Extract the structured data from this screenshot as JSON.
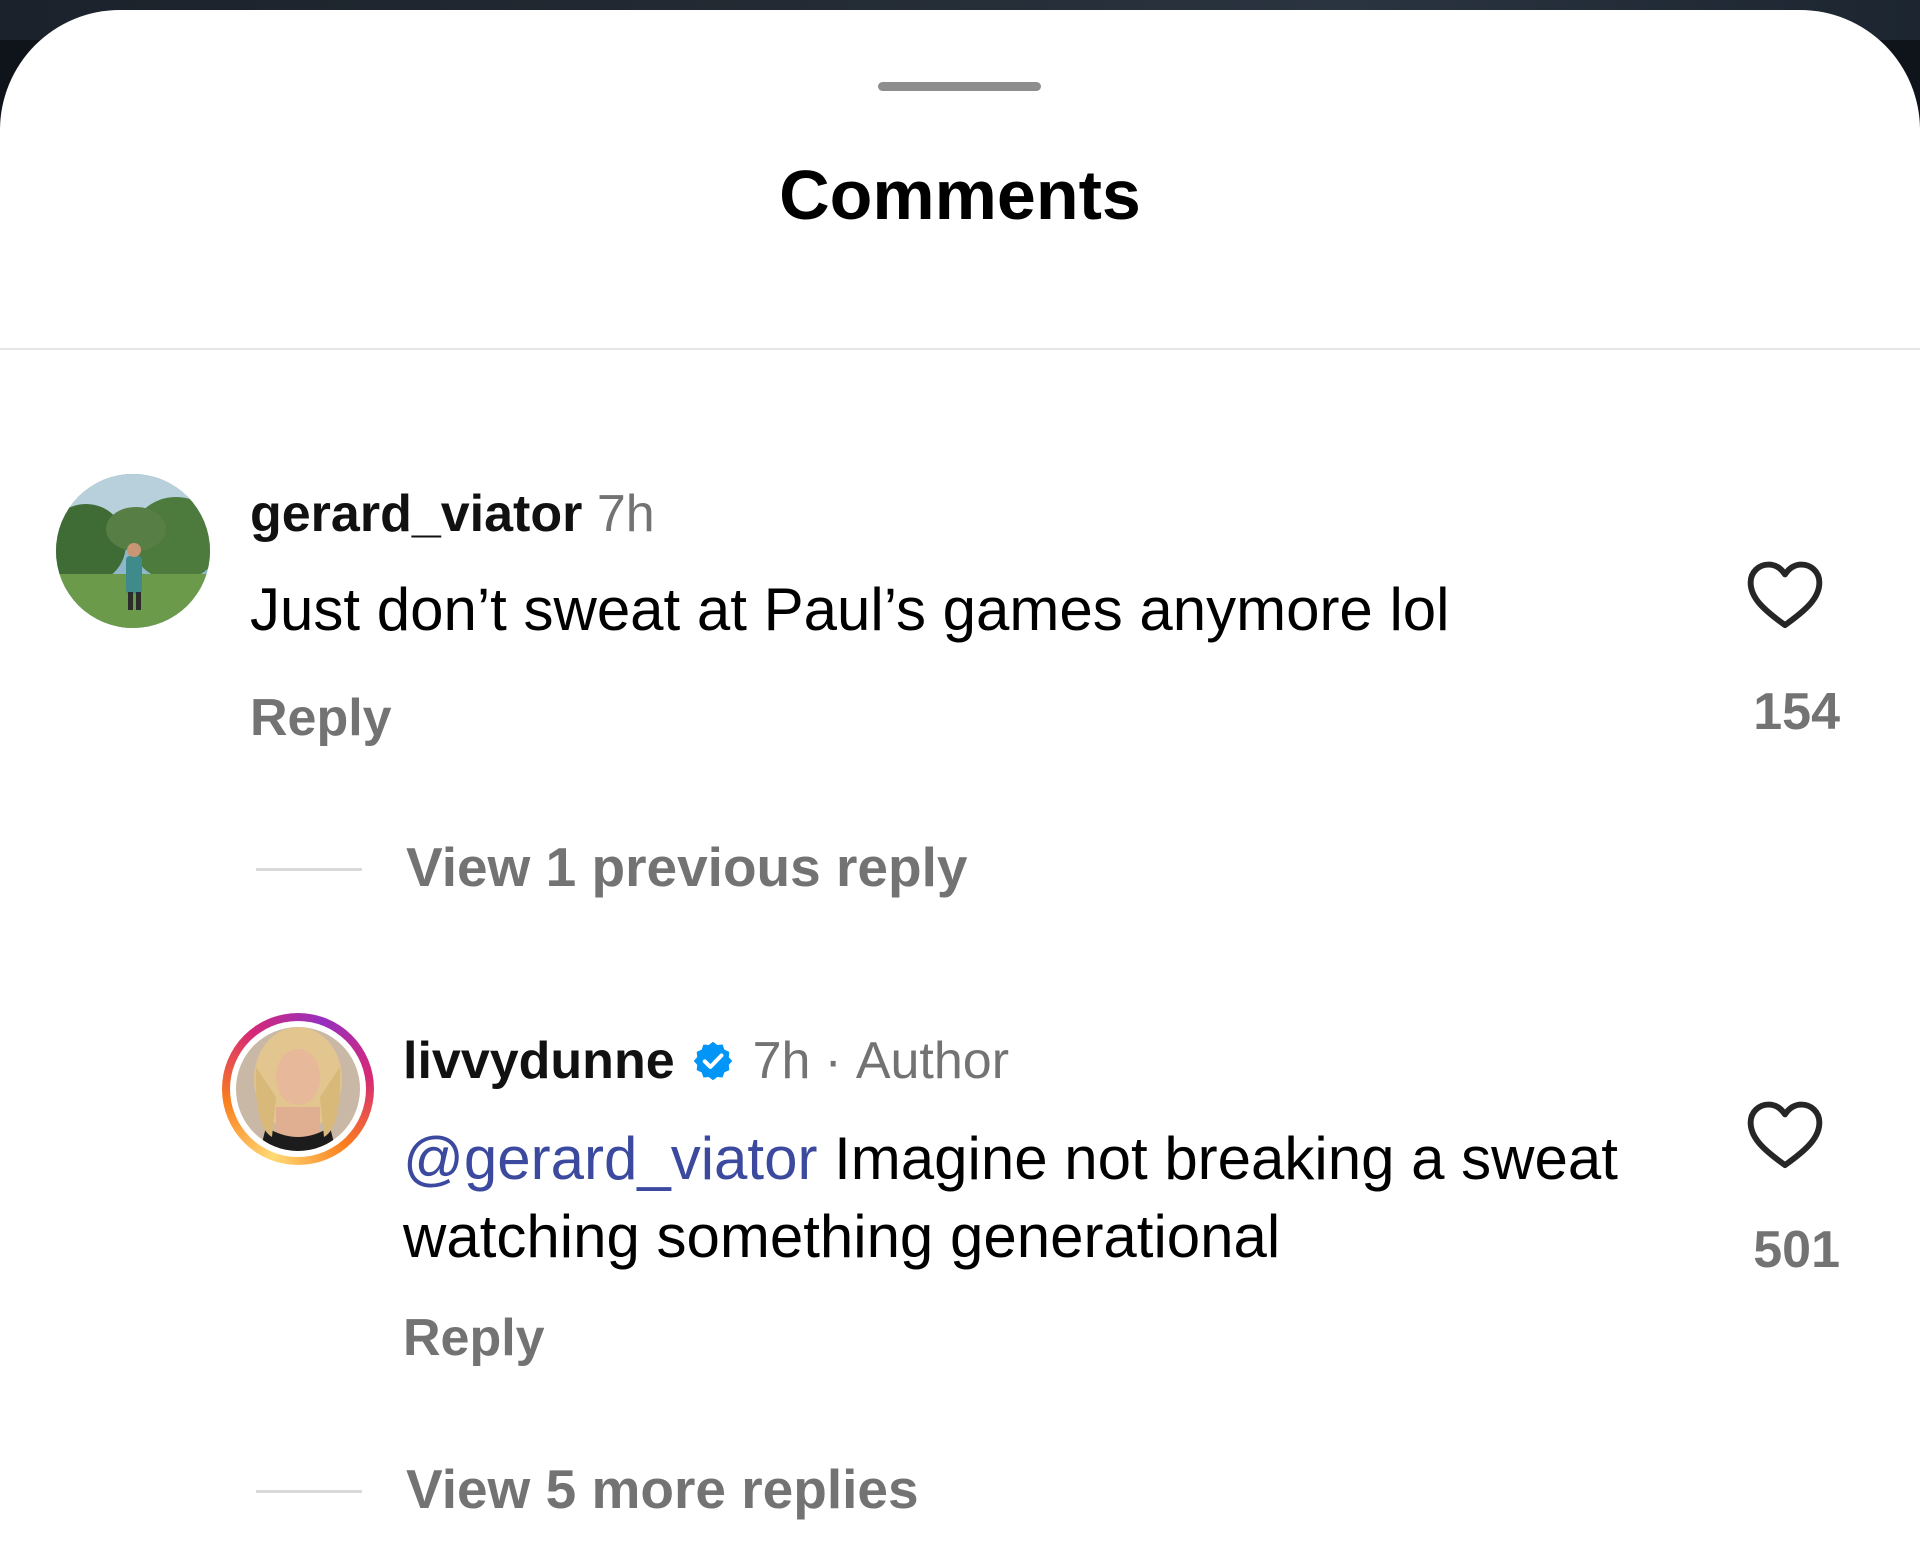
{
  "sheet": {
    "title": "Comments"
  },
  "comments": [
    {
      "username": "gerard_viator",
      "time": "7h",
      "text": "Just don’t sweat at Paul’s games anymore lol",
      "reply_label": "Reply",
      "likes": "154",
      "view_replies": "View 1 previous reply"
    },
    {
      "username": "livvydunne",
      "verified": true,
      "time": "7h",
      "separator": "·",
      "author_label": "Author",
      "mention": "@gerard_viator",
      "text": "Imagine not breaking a sweat watching something generational",
      "reply_label": "Reply",
      "likes": "501",
      "view_replies": "View 5 more replies"
    }
  ],
  "icons": {
    "like": "heart-outline-icon",
    "verified": "verified-badge-icon"
  },
  "colors": {
    "sheet_bg": "#ffffff",
    "primary_text": "#000000",
    "secondary_text": "#737373",
    "mention": "#3b4a9e",
    "verified": "#0095f6"
  }
}
